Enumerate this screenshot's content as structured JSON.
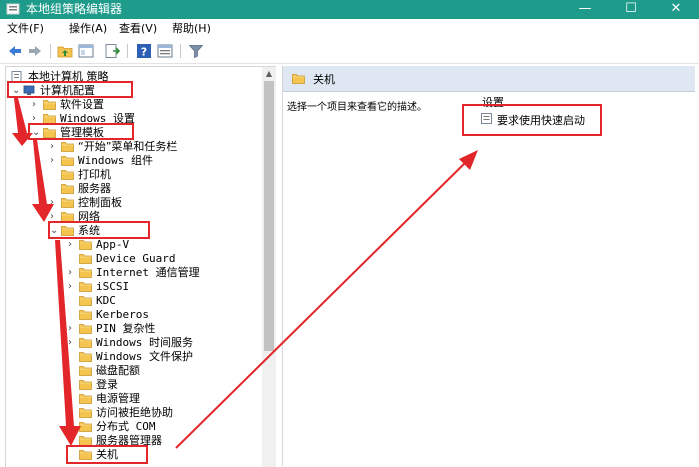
{
  "window": {
    "title": "本地组策略编辑器",
    "minimize": "—",
    "maximize": "☐",
    "close": "✕"
  },
  "menu": [
    "文件(F)",
    "操作(A)",
    "查看(V)",
    "帮助(H)"
  ],
  "toolbar_icons": [
    "back-arrow-icon",
    "forward-arrow-icon",
    "folder-up-icon",
    "show-hide-tree-icon",
    "export-list-icon",
    "help-icon",
    "properties-icon",
    "filter-icon"
  ],
  "tree": {
    "root": "本地计算机 策略",
    "computer_config": "计算机配置",
    "software_settings": "软件设置",
    "windows_settings": "Windows 设置",
    "admin_templates": "管理模板",
    "start_menu": "“开始”菜单和任务栏",
    "windows_components": "Windows 组件",
    "printers": "打印机",
    "servers": "服务器",
    "control_panel": "控制面板",
    "network": "网络",
    "system": "系统",
    "system_children": [
      "App-V",
      "Device Guard",
      "Internet 通信管理",
      "iSCSI",
      "KDC",
      "Kerberos",
      "PIN 复杂性",
      "Windows 时间服务",
      "Windows 文件保护",
      "磁盘配额",
      "登录",
      "电源管理",
      "访问被拒绝协助",
      "分布式 COM",
      "服务器管理器",
      "关机"
    ]
  },
  "right": {
    "header": "关机",
    "description": "选择一个项目来查看它的描述。",
    "column": "设置",
    "setting": "要求使用快速启动"
  },
  "colors": {
    "titlebar": "#1e9b8a",
    "annotation": "#e2262a",
    "pane_header": "#dfe8f2",
    "folder": "#f5c44f"
  }
}
